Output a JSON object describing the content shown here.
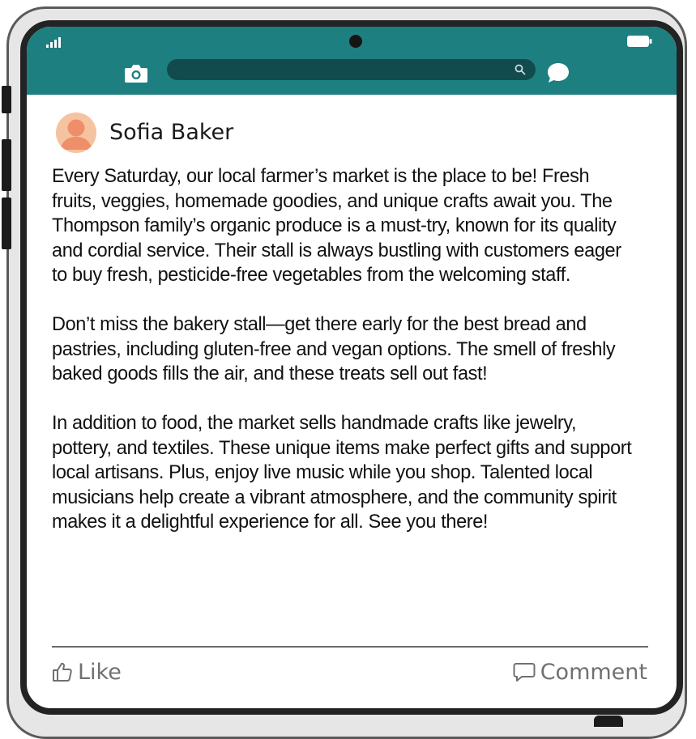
{
  "status_bar": {
    "signal_icon": "signal-bars-icon",
    "battery_icon": "battery-icon"
  },
  "app_bar": {
    "background_color": "#1d7f80",
    "left_icon": "camera-icon",
    "search_icon": "search-icon",
    "right_icon": "chat-bubble-icon"
  },
  "post": {
    "author": "Sofia Baker",
    "paragraphs": [
      "Every Saturday, our local farmer’s market is the place to be! Fresh fruits, veggies, homemade goodies, and unique crafts await you. The Thompson family’s organic produce is a must-try, known for its quality and cordial service. Their stall is always bustling with customers eager to buy fresh, pesticide-free vegetables from the welcoming staff.",
      "Don’t miss the bakery stall—get there early for the best bread and pastries, including gluten-free and vegan options. The smell of freshly baked goods fills the air, and these treats sell out fast!",
      "In addition to food, the market sells handmade crafts like jewelry, pottery, and textiles. These unique items make perfect gifts and support local artisans. Plus, enjoy live music while you shop. Talented local musicians help create a vibrant atmosphere, and the community spirit makes it a delightful experience for all. See you there!"
    ]
  },
  "actions": {
    "like_label": "Like",
    "like_icon": "thumbs-up-icon",
    "comment_label": "Comment",
    "comment_icon": "comment-bubble-icon"
  }
}
